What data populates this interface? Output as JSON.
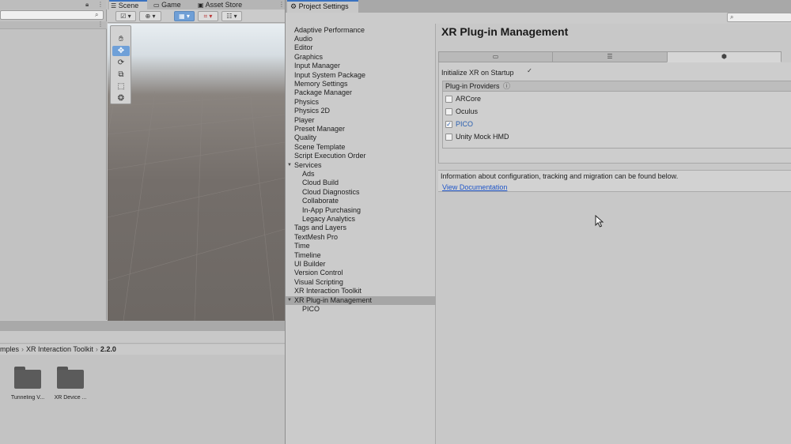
{
  "scene": {
    "tabs": [
      "Scene",
      "Game",
      "Asset Store"
    ]
  },
  "project": {
    "breadcrumb": [
      "mples",
      "XR Interaction Toolkit",
      "2.2.0"
    ],
    "folders": [
      "Tunneling V...",
      "XR Device ..."
    ]
  },
  "settings": {
    "window_tab": "Project Settings",
    "sidebar": {
      "items": [
        "Adaptive Performance",
        "Audio",
        "Editor",
        "Graphics",
        "Input Manager",
        "Input System Package",
        "Memory Settings",
        "Package Manager",
        "Physics",
        "Physics 2D",
        "Player",
        "Preset Manager",
        "Quality",
        "Scene Template",
        "Script Execution Order",
        "Services",
        "Ads",
        "Cloud Build",
        "Cloud Diagnostics",
        "Collaborate",
        "In-App Purchasing",
        "Legacy Analytics",
        "Tags and Layers",
        "TextMesh Pro",
        "Time",
        "Timeline",
        "UI Builder",
        "Version Control",
        "Visual Scripting",
        "XR Interaction Toolkit",
        "XR Plug-in Management",
        "PICO"
      ],
      "selected": "XR Plug-in Management"
    },
    "content": {
      "title": "XR Plug-in Management",
      "platform_tabs": [
        "desktop-icon",
        "server-icon",
        "android-icon"
      ],
      "active_platform": "android-icon",
      "initialize_label": "Initialize XR on Startup",
      "initialize_checked": true,
      "providers_header": "Plug-in Providers",
      "providers": [
        {
          "name": "ARCore",
          "checked": false
        },
        {
          "name": "Oculus",
          "checked": false
        },
        {
          "name": "PICO",
          "checked": true
        },
        {
          "name": "Unity Mock HMD",
          "checked": false
        }
      ],
      "info_text": "Information about configuration, tracking and migration can be found below.",
      "doc_link": "View Documentation"
    }
  }
}
